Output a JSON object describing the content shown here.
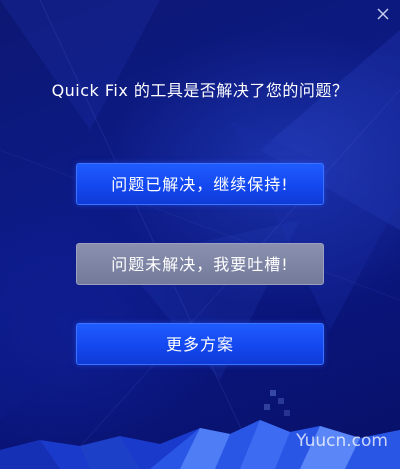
{
  "dialog": {
    "title": "Quick Fix 的工具是否解决了您的问题？",
    "close_icon": "close-icon"
  },
  "buttons": {
    "resolved_label": "问题已解决，继续保持!",
    "unresolved_label": "问题未解决，我要吐槽!",
    "more_label": "更多方案"
  },
  "watermark": "Yuucn.com",
  "colors": {
    "background": "#0c1a86",
    "primary_button": "#1a52f8",
    "gray_button": "#7d84a4",
    "text": "#ffffff"
  }
}
